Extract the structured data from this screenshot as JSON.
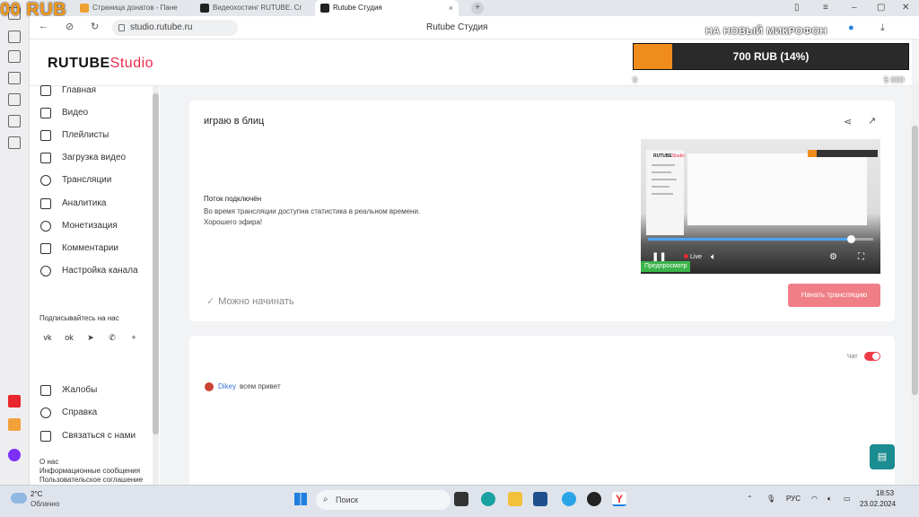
{
  "overlay": {
    "top_left_text": "00 RUB",
    "donation_label": "НА НОВЫЙ МИКРОФОН",
    "donation_progress_text": "700 RUB (14%)",
    "donation_progress": 0.14,
    "donation_min": "0",
    "donation_max": "5 000",
    "fill_color": "#f08c1c"
  },
  "browser": {
    "tabs": [
      {
        "label": "Страница донатов - Пане"
      },
      {
        "label": "Видеохостинг RUTUBE. Cr"
      },
      {
        "label": "Rutube Студия"
      }
    ],
    "url": "studio.rutube.ru",
    "page_title": "Rutube Студия"
  },
  "header": {
    "logo_main": "RUTUBE",
    "logo_accent": "Studio",
    "accent_color": "#ed2a4a"
  },
  "sidebar": {
    "items": [
      {
        "label": "Главная",
        "icon": "home-icon"
      },
      {
        "label": "Видео",
        "icon": "video-icon"
      },
      {
        "label": "Плейлисты",
        "icon": "playlist-icon"
      },
      {
        "label": "Загрузка видео",
        "icon": "upload-icon"
      },
      {
        "label": "Трансляции",
        "icon": "broadcast-icon"
      },
      {
        "label": "Аналитика",
        "icon": "analytics-icon"
      },
      {
        "label": "Монетизация",
        "icon": "monetization-icon"
      },
      {
        "label": "Комментарии",
        "icon": "comments-icon"
      },
      {
        "label": "Настройка канала",
        "icon": "settings-icon"
      }
    ],
    "subscribe_label": "Подписывайтесь на нас",
    "social": [
      "vk",
      "ok",
      "telegram",
      "viber",
      "plus"
    ],
    "bottom_items": [
      {
        "label": "Жалобы",
        "icon": "flag-icon"
      },
      {
        "label": "Справка",
        "icon": "help-icon"
      },
      {
        "label": "Связаться с нами",
        "icon": "contact-icon"
      }
    ],
    "about": [
      "О нас",
      "Информационные сообщения",
      "Пользовательское соглашение"
    ]
  },
  "stream": {
    "name": "играю в блиц",
    "connected_title": "Поток подключён",
    "connected_line1": "Во время трансляции доступна статистика в реальном времени.",
    "connected_line2": "Хорошего эфира!",
    "ready_text": "Можно начинать",
    "start_button": "Начать трансляцию",
    "preview_badge": "Предпросмотр",
    "live_label": "Live",
    "preview_progress": 0.9
  },
  "chat": {
    "label": "Чат",
    "enabled": true,
    "messages": [
      {
        "user": "Dikey",
        "text": "всем привет"
      }
    ]
  },
  "taskbar": {
    "temperature": "2°C",
    "weather": "Облачно",
    "search": "Поиск",
    "lang": "РУС",
    "time": "18:53",
    "date": "23.02.2024"
  }
}
